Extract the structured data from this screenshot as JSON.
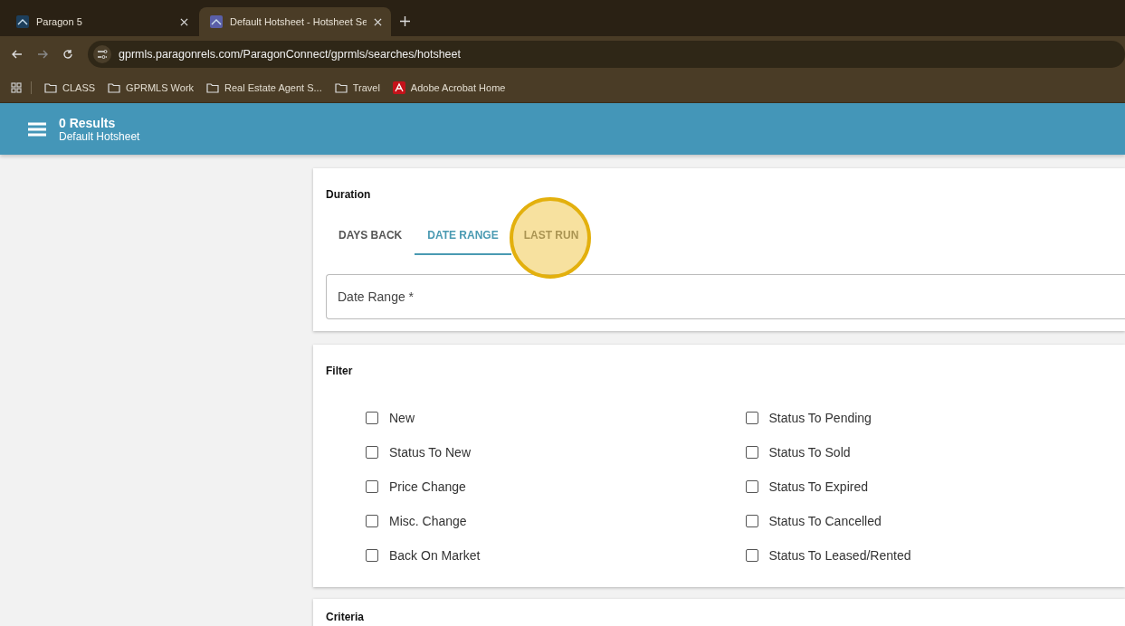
{
  "browser": {
    "tabs": [
      {
        "title": "Paragon 5",
        "selected": false
      },
      {
        "title": "Default Hotsheet - Hotsheet Se",
        "selected": true
      }
    ],
    "url": "gprmls.paragonrels.com/ParagonConnect/gprmls/searches/hotsheet",
    "bookmarks": [
      {
        "label": "CLASS",
        "kind": "folder"
      },
      {
        "label": "GPRMLS Work",
        "kind": "folder"
      },
      {
        "label": "Real Estate Agent S...",
        "kind": "folder"
      },
      {
        "label": "Travel",
        "kind": "folder"
      },
      {
        "label": "Adobe Acrobat Home",
        "kind": "pdf"
      }
    ]
  },
  "header": {
    "title": "0 Results",
    "subtitle": "Default Hotsheet"
  },
  "duration": {
    "heading": "Duration",
    "tabs": [
      {
        "label": "DAYS BACK",
        "selected": false
      },
      {
        "label": "DATE RANGE",
        "selected": true
      },
      {
        "label": "LAST RUN",
        "selected": false
      }
    ],
    "field": {
      "placeholder": "Date Range *"
    }
  },
  "filter": {
    "heading": "Filter",
    "columns": [
      [
        {
          "label": "New",
          "checked": false
        },
        {
          "label": "Status To New",
          "checked": false
        },
        {
          "label": "Price Change",
          "checked": false
        },
        {
          "label": "Misc. Change",
          "checked": false
        },
        {
          "label": "Back On Market",
          "checked": false
        }
      ],
      [
        {
          "label": "Status To Pending",
          "checked": false
        },
        {
          "label": "Status To Sold",
          "checked": false
        },
        {
          "label": "Status To Expired",
          "checked": false
        },
        {
          "label": "Status To Cancelled",
          "checked": false
        },
        {
          "label": "Status To Leased/Rented",
          "checked": false
        }
      ]
    ]
  },
  "criteria": {
    "heading": "Criteria"
  }
}
